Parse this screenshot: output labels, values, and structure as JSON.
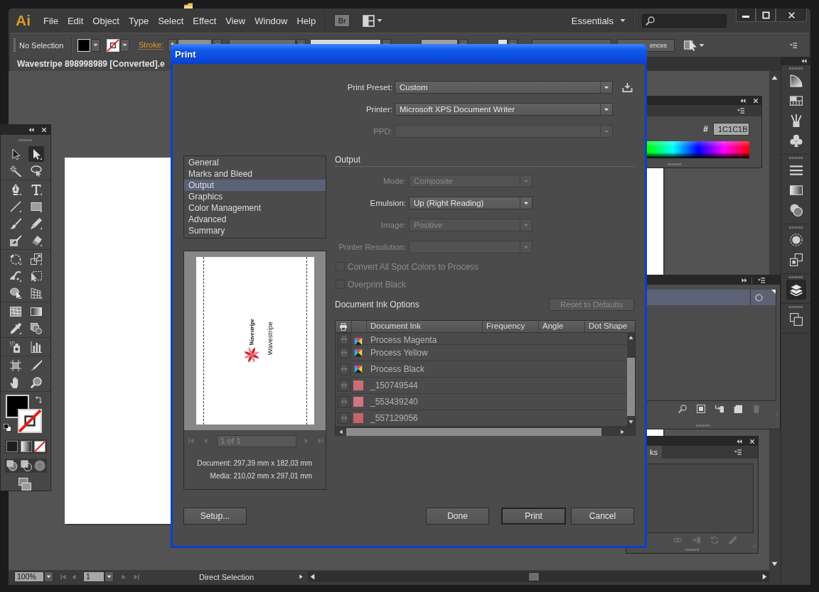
{
  "menu_bar": {
    "logo": "Ai",
    "menus": [
      "File",
      "Edit",
      "Object",
      "Type",
      "Select",
      "Effect",
      "View",
      "Window",
      "Help"
    ],
    "bridge_button": "Br",
    "workspace": "Essentials"
  },
  "control_bar": {
    "selection": "No Selection",
    "stroke_label": "Stroke:",
    "preferences_button": "ences"
  },
  "document_tab": {
    "title": "Wavestripe 898998989 [Converted].e"
  },
  "toolbox": {
    "tool_groups": [
      {
        "tools": [
          {
            "kind": "pointer",
            "selected": false
          },
          {
            "kind": "direct-pointer",
            "selected": true
          },
          {
            "kind": "magic-wand",
            "selected": false
          },
          {
            "kind": "lasso",
            "selected": false
          }
        ]
      },
      {
        "tools": [
          {
            "kind": "pen",
            "selected": false
          },
          {
            "kind": "type",
            "selected": false
          },
          {
            "kind": "line",
            "selected": false
          },
          {
            "kind": "rectangle",
            "selected": false
          },
          {
            "kind": "paintbrush",
            "selected": false
          },
          {
            "kind": "pencil",
            "selected": false
          },
          {
            "kind": "blob-brush",
            "selected": false
          },
          {
            "kind": "eraser",
            "selected": false
          }
        ]
      },
      {
        "tools": [
          {
            "kind": "rotate",
            "selected": false
          },
          {
            "kind": "scale",
            "selected": false
          },
          {
            "kind": "warp",
            "selected": false
          },
          {
            "kind": "free-transform",
            "selected": false
          },
          {
            "kind": "shape-builder",
            "selected": false
          },
          {
            "kind": "perspective-grid",
            "selected": false
          }
        ]
      },
      {
        "tools": [
          {
            "kind": "mesh",
            "selected": false
          },
          {
            "kind": "gradient",
            "selected": false
          },
          {
            "kind": "eyedropper",
            "selected": false
          },
          {
            "kind": "blend",
            "selected": false
          }
        ]
      },
      {
        "tools": [
          {
            "kind": "spray-can",
            "selected": false
          },
          {
            "kind": "bar-graph",
            "selected": false
          }
        ]
      },
      {
        "tools": [
          {
            "kind": "artboard",
            "selected": false
          },
          {
            "kind": "knife",
            "selected": false
          },
          {
            "kind": "hand",
            "selected": false
          },
          {
            "kind": "zoom",
            "selected": false
          }
        ]
      }
    ]
  },
  "dock": {
    "groups": [
      {
        "panels": [
          {
            "kind": "quarter-circle",
            "selected": false
          },
          {
            "kind": "swatch-grid",
            "selected": false
          },
          {
            "kind": "brushes",
            "selected": false
          },
          {
            "kind": "club",
            "selected": false
          }
        ]
      },
      {
        "panels": [
          {
            "kind": "stroke-lines",
            "selected": false
          },
          {
            "kind": "gradient",
            "selected": false
          },
          {
            "kind": "overlapping-circles",
            "selected": false
          }
        ]
      },
      {
        "panels": [
          {
            "kind": "dashed-circle",
            "selected": false
          },
          {
            "kind": "stacked-squares",
            "selected": false
          }
        ]
      },
      {
        "panels": [
          {
            "kind": "layers",
            "selected": true
          }
        ]
      },
      {
        "panels": [
          {
            "kind": "artboards",
            "selected": false
          }
        ]
      }
    ]
  },
  "color_panel": {
    "hex_label": "#",
    "hex_value": "1C1C1B"
  },
  "layers_panel": {
    "layer_row": {
      "selected": true
    }
  },
  "links_panel": {
    "tab": "ks"
  },
  "status_bar": {
    "zoom": "100%",
    "artboard": "1",
    "tool": "Direct Selection"
  },
  "print_dialog": {
    "title": "Print",
    "settings": [
      {
        "label": "Print Preset:",
        "value": "Custom",
        "disabled": false
      },
      {
        "label": "Printer:",
        "value": "Microsoft XPS Document Writer",
        "disabled": false
      },
      {
        "label": "PPD:",
        "disabled": true
      }
    ],
    "categories": [
      {
        "label": "General",
        "selected": false
      },
      {
        "label": "Marks and Bleed",
        "selected": false
      },
      {
        "label": "Output",
        "selected": true
      },
      {
        "label": "Graphics",
        "selected": false
      },
      {
        "label": "Color Management",
        "selected": false
      },
      {
        "label": "Advanced",
        "selected": false
      },
      {
        "label": "Summary",
        "selected": false
      }
    ],
    "preview": {
      "logo_text": "Wavestripe",
      "brand_text": "Wavestripe",
      "page_field": "1 of 1",
      "document_size": "Document: 297,39 mm x 182,03 mm",
      "media_size": "Media: 210,02 mm x 297,01 mm"
    },
    "section_title": "Output",
    "fields": [
      {
        "label": "Mode:",
        "value": "Composite",
        "disabled": true
      },
      {
        "label": "Emulsion:",
        "value": "Up (Right Reading)",
        "disabled": false
      },
      {
        "label": "Image:",
        "value": "Positive",
        "disabled": true
      },
      {
        "label": "Printer Resolution:",
        "disabled": true
      }
    ],
    "checkboxes": [
      {
        "label": "Convert All Spot Colors to Process",
        "checked": false,
        "disabled": true
      },
      {
        "label": "Overprint Black",
        "checked": false,
        "disabled": true
      }
    ],
    "ink_options": {
      "title": "Document Ink Options",
      "reset_button": {
        "label": "Reset to Defaults",
        "disabled": true
      },
      "columns": [
        "Document Ink",
        "Frequency",
        "Angle",
        "Dot Shape"
      ],
      "rows": [
        {
          "name": "Process Magenta",
          "kind": "process"
        },
        {
          "name": "Process Yellow",
          "kind": "process"
        },
        {
          "name": "Process Black",
          "kind": "process"
        },
        {
          "name": "_150749544",
          "kind": "spot",
          "color": "#c86e74"
        },
        {
          "name": "_553439240",
          "kind": "spot",
          "color": "#cf7584"
        },
        {
          "name": "_557129056",
          "kind": "spot",
          "color": "#c4636b"
        }
      ]
    },
    "buttons": [
      {
        "label": "Setup...",
        "default": false
      },
      {
        "label": "Done",
        "default": false
      },
      {
        "label": "Print",
        "default": true
      },
      {
        "label": "Cancel",
        "default": false
      }
    ]
  }
}
